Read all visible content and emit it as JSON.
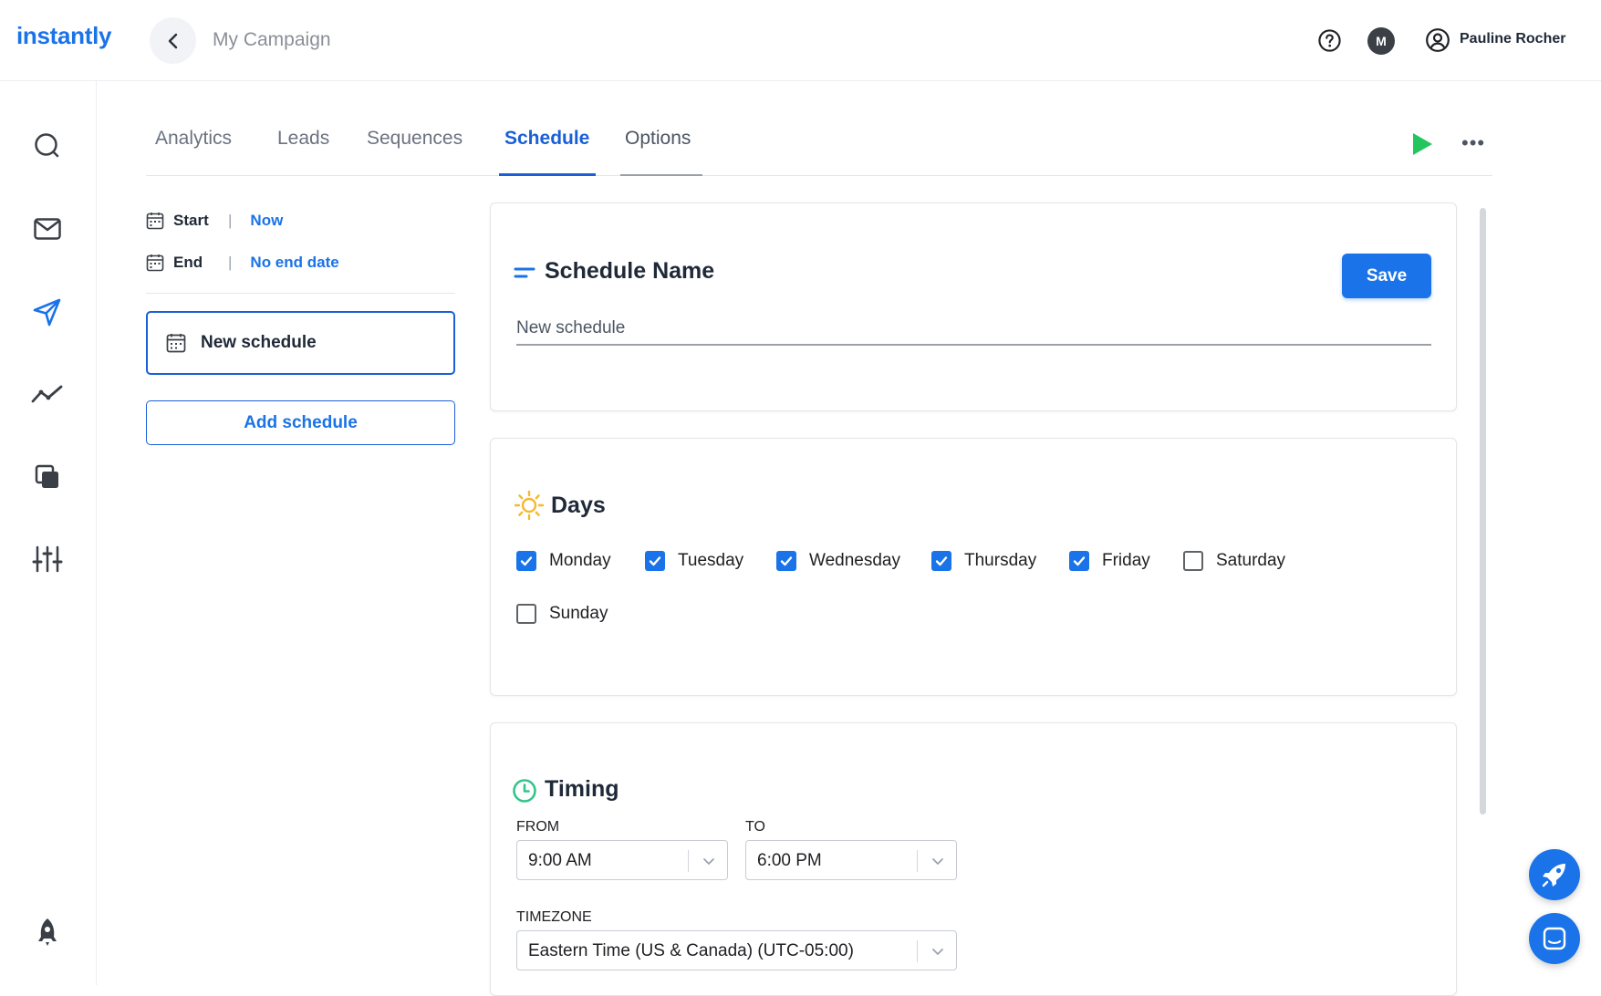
{
  "app": {
    "logo_text": "instantly",
    "breadcrumb": "My Campaign"
  },
  "header": {
    "avatar_initial": "M",
    "user_name": "Pauline Rocher"
  },
  "sidebar": {
    "items": [
      {
        "icon": "search-icon"
      },
      {
        "icon": "mail-icon"
      },
      {
        "icon": "send-icon"
      },
      {
        "icon": "analytics-icon"
      },
      {
        "icon": "copy-icon"
      },
      {
        "icon": "sliders-icon"
      },
      {
        "icon": "rocket-icon"
      }
    ]
  },
  "tabs": [
    {
      "label": "Analytics"
    },
    {
      "label": "Leads"
    },
    {
      "label": "Sequences"
    },
    {
      "label": "Schedule"
    },
    {
      "label": "Options"
    }
  ],
  "active_tab": "Schedule",
  "dates": {
    "start_label": "Start",
    "start_value": "Now",
    "end_label": "End",
    "end_value": "No end date"
  },
  "schedules": {
    "current": "New schedule",
    "add_label": "Add schedule"
  },
  "schedule_name": {
    "title": "Schedule Name",
    "save_label": "Save",
    "value": "New schedule"
  },
  "days": {
    "title": "Days",
    "items": [
      {
        "label": "Monday",
        "checked": true
      },
      {
        "label": "Tuesday",
        "checked": true
      },
      {
        "label": "Wednesday",
        "checked": true
      },
      {
        "label": "Thursday",
        "checked": true
      },
      {
        "label": "Friday",
        "checked": true
      },
      {
        "label": "Saturday",
        "checked": false
      },
      {
        "label": "Sunday",
        "checked": false
      }
    ]
  },
  "timing": {
    "title": "Timing",
    "from_label": "FROM",
    "from_value": "9:00 AM",
    "to_label": "TO",
    "to_value": "6:00 PM",
    "timezone_label": "TIMEZONE",
    "timezone_value": "Eastern Time (US & Canada) (UTC-05:00)"
  },
  "colors": {
    "accent": "#1a73e8",
    "play_green": "#22c55e",
    "sun_yellow": "#f5b82e",
    "clock_green": "#34c48b"
  }
}
